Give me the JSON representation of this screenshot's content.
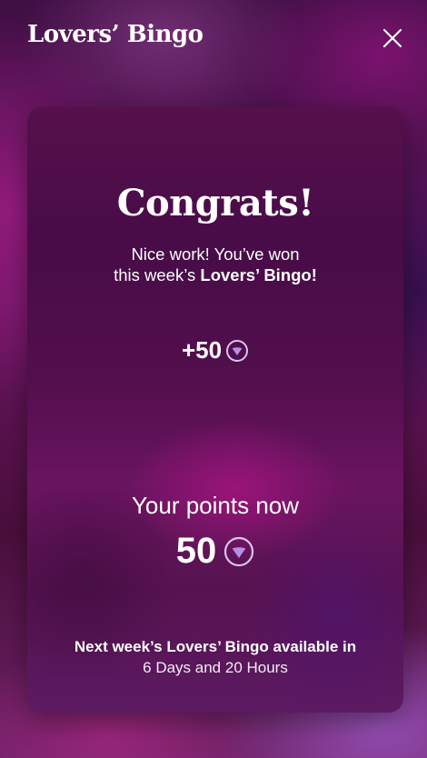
{
  "header": {
    "title": "Lovers’ Bingo",
    "close_icon": "close-icon"
  },
  "card": {
    "headline": "Congrats!",
    "message_line1": "Nice work! You’ve won",
    "message_line2_prefix": "this week’s ",
    "message_line2_bold": "Lovers’ Bingo!",
    "reward": "+50",
    "reward_icon": "heart-gem-icon",
    "points_label": "Your points now",
    "points_value": "50",
    "points_icon": "heart-gem-icon",
    "next_label": "Next week’s Lovers’ Bingo available in",
    "countdown": "6 Days and 20 Hours"
  },
  "colors": {
    "gem_stroke": "#d9c3f2",
    "gem_fill": "#b58ee6"
  }
}
